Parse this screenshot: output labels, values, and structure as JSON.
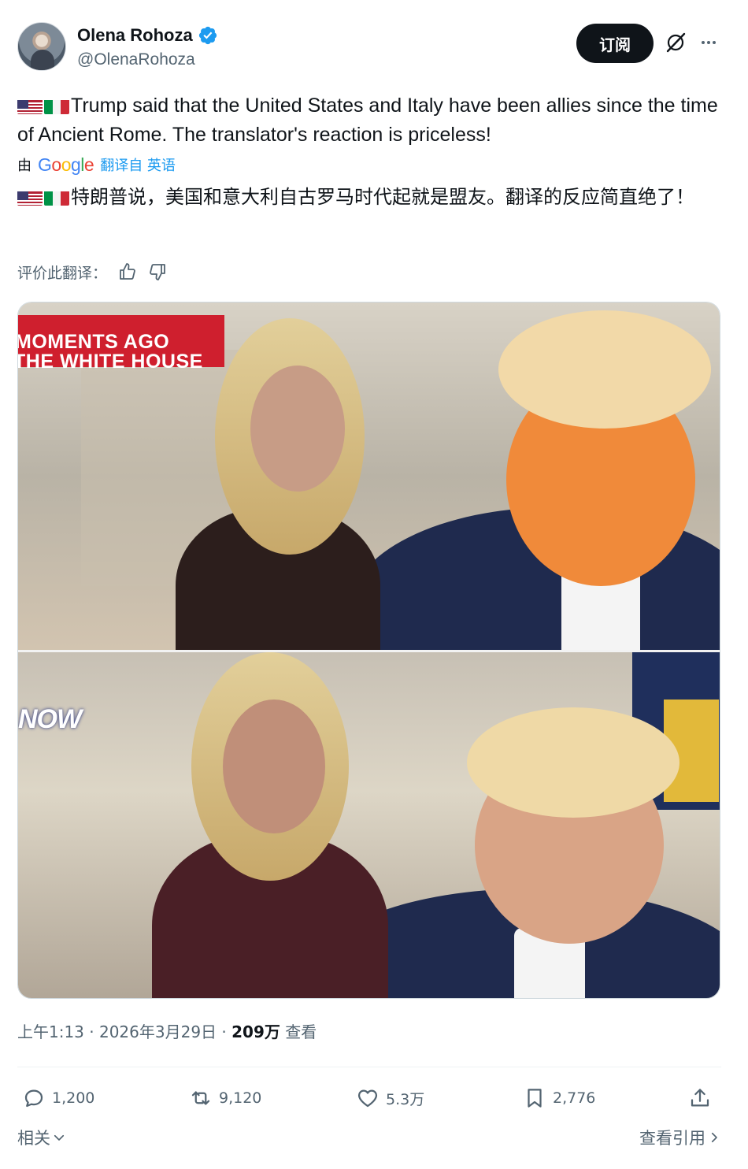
{
  "author": {
    "name": "Olena Rohoza",
    "handle": "@OlenaRohoza"
  },
  "header": {
    "subscribe_label": "订阅"
  },
  "post": {
    "original_text": "Trump said that the United States and Italy have been allies since the time of Ancient Rome. The translator's reaction is priceless!",
    "translation_by_label": "由",
    "translation_from_label": "翻译自 英语",
    "translated_text": "特朗普说，美国和意大利自古罗马时代起就是盟友。翻译的反应简直绝了！",
    "rate_translation_label": "评价此翻译：",
    "media": {
      "banner_line1": "MOMENTS AGO",
      "banner_line2": "THE WHITE HOUSE",
      "network_logo": "NOW"
    },
    "timestamp": "上午1:13 · 2026年3月29日 · ",
    "views_count": "209万",
    "views_label": " 查看"
  },
  "actions": {
    "replies": "1,200",
    "reposts": "9,120",
    "likes": "5.3万",
    "bookmarks": "2,776"
  },
  "footer": {
    "related_label": "相关",
    "view_quotes_label": "查看引用"
  },
  "colors": {
    "accent": "#1d9bf0",
    "text_primary": "#0f1419",
    "text_secondary": "#536471",
    "banner_red": "#cf1f2e"
  }
}
